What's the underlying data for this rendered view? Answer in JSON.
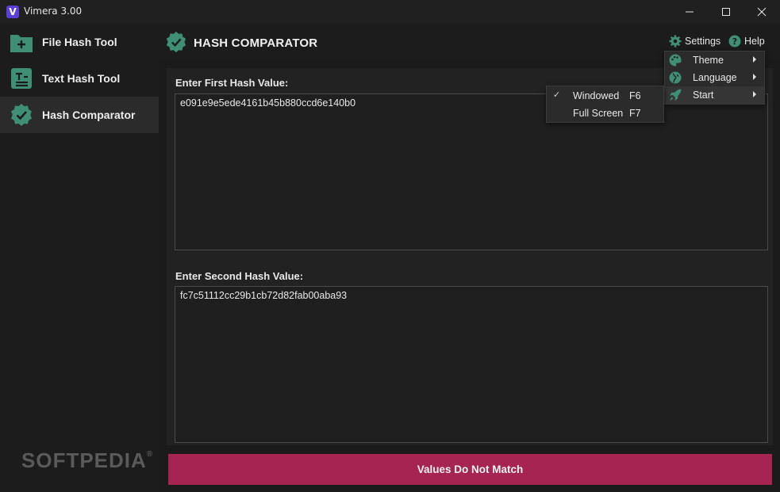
{
  "window": {
    "title": "Vimera 3.00",
    "logo_letter": "V"
  },
  "sidebar": {
    "items": [
      {
        "label": "File Hash Tool",
        "icon": "folder-plus-icon"
      },
      {
        "label": "Text Hash Tool",
        "icon": "text-document-icon"
      },
      {
        "label": "Hash Comparator",
        "icon": "verified-badge-icon",
        "active": true
      }
    ],
    "watermark": "SOFTPEDIA",
    "watermark_mark": "®"
  },
  "header": {
    "title": "HASH COMPARATOR",
    "settings_label": "Settings",
    "help_label": "Help"
  },
  "settings_menu": {
    "items": [
      {
        "label": "Theme",
        "icon": "palette-icon"
      },
      {
        "label": "Language",
        "icon": "globe-icon"
      },
      {
        "label": "Start",
        "icon": "rocket-icon"
      }
    ]
  },
  "start_menu": {
    "items": [
      {
        "label": "Windowed",
        "shortcut": "F6",
        "checked": true
      },
      {
        "label": "Full Screen",
        "shortcut": "F7",
        "checked": false
      }
    ],
    "check_glyph": "✓"
  },
  "form": {
    "first_label": "Enter First Hash Value:",
    "first_value": "e091e9e5ede4161b45b880ccd6e140b0",
    "second_label": "Enter Second Hash Value:",
    "second_value": "fc7c51112cc29b1cb72d82fab00aba93"
  },
  "result": {
    "text": "Values Do Not Match",
    "color": "#a52451"
  },
  "colors": {
    "accent_green": "#3f8f76",
    "background": "#1b1b1b"
  }
}
